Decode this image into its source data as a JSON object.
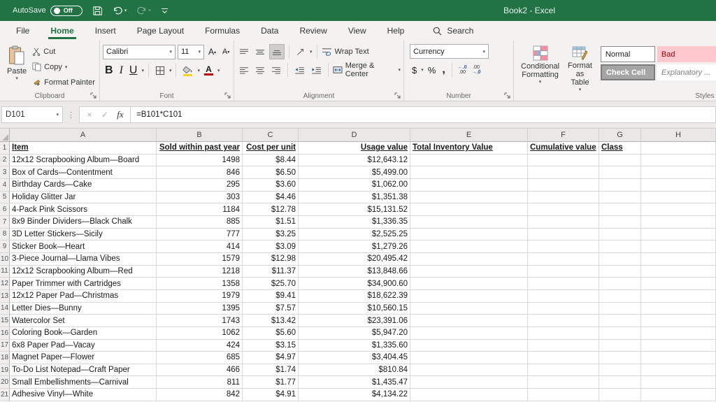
{
  "title_bar": {
    "autosave_label": "AutoSave",
    "autosave_state": "Off",
    "title": "Book2 - Excel"
  },
  "tabs": [
    {
      "label": "File",
      "active": false
    },
    {
      "label": "Home",
      "active": true
    },
    {
      "label": "Insert",
      "active": false
    },
    {
      "label": "Page Layout",
      "active": false
    },
    {
      "label": "Formulas",
      "active": false
    },
    {
      "label": "Data",
      "active": false
    },
    {
      "label": "Review",
      "active": false
    },
    {
      "label": "View",
      "active": false
    },
    {
      "label": "Help",
      "active": false
    }
  ],
  "search_label": "Search",
  "ribbon": {
    "clipboard": {
      "group_label": "Clipboard",
      "paste_label": "Paste",
      "cut_label": "Cut",
      "copy_label": "Copy",
      "format_painter_label": "Format Painter"
    },
    "font": {
      "group_label": "Font",
      "font_name": "Calibri",
      "font_size": "11",
      "bold": "B",
      "italic": "I",
      "underline": "U"
    },
    "alignment": {
      "group_label": "Alignment",
      "wrap_text_label": "Wrap Text",
      "merge_center_label": "Merge & Center"
    },
    "number": {
      "group_label": "Number",
      "format_value": "Currency",
      "currency_symbol": "$",
      "percent_symbol": "%",
      "comma_symbol": ","
    },
    "styles": {
      "group_label": "Styles",
      "conditional_formatting_label": "Conditional Formatting",
      "format_as_table_label": "Format as Table",
      "cell_styles": [
        {
          "label": "Normal",
          "style": "normal"
        },
        {
          "label": "Bad",
          "style": "bad"
        },
        {
          "label": "Check Cell",
          "style": "check"
        },
        {
          "label": "Explanatory ...",
          "style": "explanatory"
        }
      ]
    }
  },
  "formula_bar": {
    "name_box": "D101",
    "formula": "=B101*C101",
    "fx_label": "fx"
  },
  "sheet": {
    "column_letters": [
      "A",
      "B",
      "C",
      "D",
      "E",
      "F",
      "G",
      "H"
    ],
    "header_row": {
      "num": "1",
      "cells": [
        "Item",
        "Sold within past year",
        "Cost per unit",
        "Usage value",
        "Total Inventory Value",
        "Cumulative value",
        "Class",
        ""
      ]
    },
    "rows": [
      {
        "num": "2",
        "cells": [
          "12x12 Scrapbooking Album—Board",
          "1498",
          "$8.44",
          "$12,643.12",
          "",
          "",
          "",
          ""
        ]
      },
      {
        "num": "3",
        "cells": [
          "Box of Cards—Contentment",
          "846",
          "$6.50",
          "$5,499.00",
          "",
          "",
          "",
          ""
        ]
      },
      {
        "num": "4",
        "cells": [
          "Birthday Cards—Cake",
          "295",
          "$3.60",
          "$1,062.00",
          "",
          "",
          "",
          ""
        ]
      },
      {
        "num": "5",
        "cells": [
          "Holiday Glitter Jar",
          "303",
          "$4.46",
          "$1,351.38",
          "",
          "",
          "",
          ""
        ]
      },
      {
        "num": "6",
        "cells": [
          "4-Pack Pink Scissors",
          "1184",
          "$12.78",
          "$15,131.52",
          "",
          "",
          "",
          ""
        ]
      },
      {
        "num": "7",
        "cells": [
          "8x9 Binder Dividers—Black Chalk",
          "885",
          "$1.51",
          "$1,336.35",
          "",
          "",
          "",
          ""
        ]
      },
      {
        "num": "8",
        "cells": [
          "3D Letter Stickers—Sicily",
          "777",
          "$3.25",
          "$2,525.25",
          "",
          "",
          "",
          ""
        ]
      },
      {
        "num": "9",
        "cells": [
          "Sticker Book—Heart",
          "414",
          "$3.09",
          "$1,279.26",
          "",
          "",
          "",
          ""
        ]
      },
      {
        "num": "10",
        "cells": [
          "3-Piece Journal—Llama Vibes",
          "1579",
          "$12.98",
          "$20,495.42",
          "",
          "",
          "",
          ""
        ]
      },
      {
        "num": "11",
        "cells": [
          "12x12 Scrapbooking Album—Red",
          "1218",
          "$11.37",
          "$13,848.66",
          "",
          "",
          "",
          ""
        ]
      },
      {
        "num": "12",
        "cells": [
          "Paper Trimmer with Cartridges",
          "1358",
          "$25.70",
          "$34,900.60",
          "",
          "",
          "",
          ""
        ]
      },
      {
        "num": "13",
        "cells": [
          "12x12 Paper Pad—Christmas",
          "1979",
          "$9.41",
          "$18,622.39",
          "",
          "",
          "",
          ""
        ]
      },
      {
        "num": "14",
        "cells": [
          "Letter Dies—Bunny",
          "1395",
          "$7.57",
          "$10,560.15",
          "",
          "",
          "",
          ""
        ]
      },
      {
        "num": "15",
        "cells": [
          "Watercolor Set",
          "1743",
          "$13.42",
          "$23,391.06",
          "",
          "",
          "",
          ""
        ]
      },
      {
        "num": "16",
        "cells": [
          "Coloring Book—Garden",
          "1062",
          "$5.60",
          "$5,947.20",
          "",
          "",
          "",
          ""
        ]
      },
      {
        "num": "17",
        "cells": [
          "6x8 Paper Pad—Vacay",
          "424",
          "$3.15",
          "$1,335.60",
          "",
          "",
          "",
          ""
        ]
      },
      {
        "num": "18",
        "cells": [
          "Magnet Paper—Flower",
          "685",
          "$4.97",
          "$3,404.45",
          "",
          "",
          "",
          ""
        ]
      },
      {
        "num": "19",
        "cells": [
          "To-Do List Notepad—Craft Paper",
          "466",
          "$1.74",
          "$810.84",
          "",
          "",
          "",
          ""
        ]
      },
      {
        "num": "20",
        "cells": [
          "Small Embellishments—Carnival",
          "811",
          "$1.77",
          "$1,435.47",
          "",
          "",
          "",
          ""
        ]
      },
      {
        "num": "21",
        "cells": [
          "Adhesive Vinyl—White",
          "842",
          "$4.91",
          "$4,134.22",
          "",
          "",
          "",
          ""
        ]
      }
    ]
  },
  "colors": {
    "title_bar_green": "#217346",
    "active_tab_green": "#217346",
    "bad_bg": "#ffc7ce",
    "bad_text": "#9c0006",
    "check_cell_bg": "#a5a5a5",
    "font_color_red": "#c00000"
  }
}
